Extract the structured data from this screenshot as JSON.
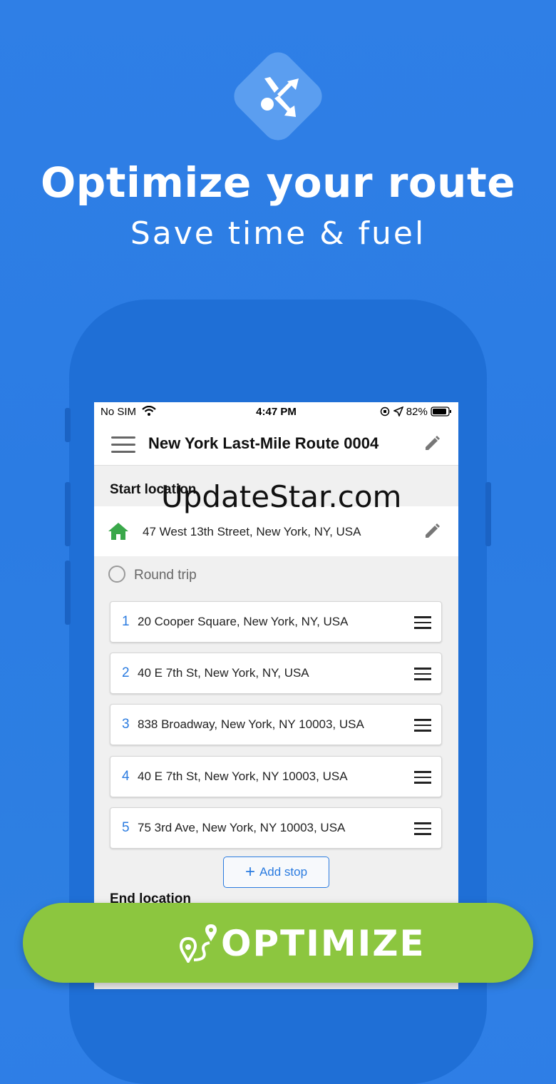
{
  "promo": {
    "headline": "Optimize your route",
    "subline": "Save time & fuel",
    "watermark": "UpdateStar.com",
    "optimize_label": "OPTIMIZE"
  },
  "status": {
    "carrier": "No SIM",
    "time": "4:47 PM",
    "battery": "82%"
  },
  "appbar": {
    "title": "New York Last-Mile Route 0004"
  },
  "start": {
    "label": "Start location",
    "address": "47 West 13th Street, New York, NY, USA"
  },
  "round_trip": "Round trip",
  "stops": [
    {
      "num": "1",
      "address": "20 Cooper Square, New York, NY, USA"
    },
    {
      "num": "2",
      "address": "40 E 7th St, New York, NY, USA"
    },
    {
      "num": "3",
      "address": "838 Broadway, New York, NY 10003, USA"
    },
    {
      "num": "4",
      "address": "40 E 7th St, New York, NY 10003, USA"
    },
    {
      "num": "5",
      "address": "75 3rd Ave, New York, NY 10003, USA"
    }
  ],
  "add_stop": "Add stop",
  "end": {
    "label": "End location"
  },
  "colors": {
    "accent": "#2a7be0",
    "optimize": "#8cc63f",
    "home": "#3aa84a"
  }
}
